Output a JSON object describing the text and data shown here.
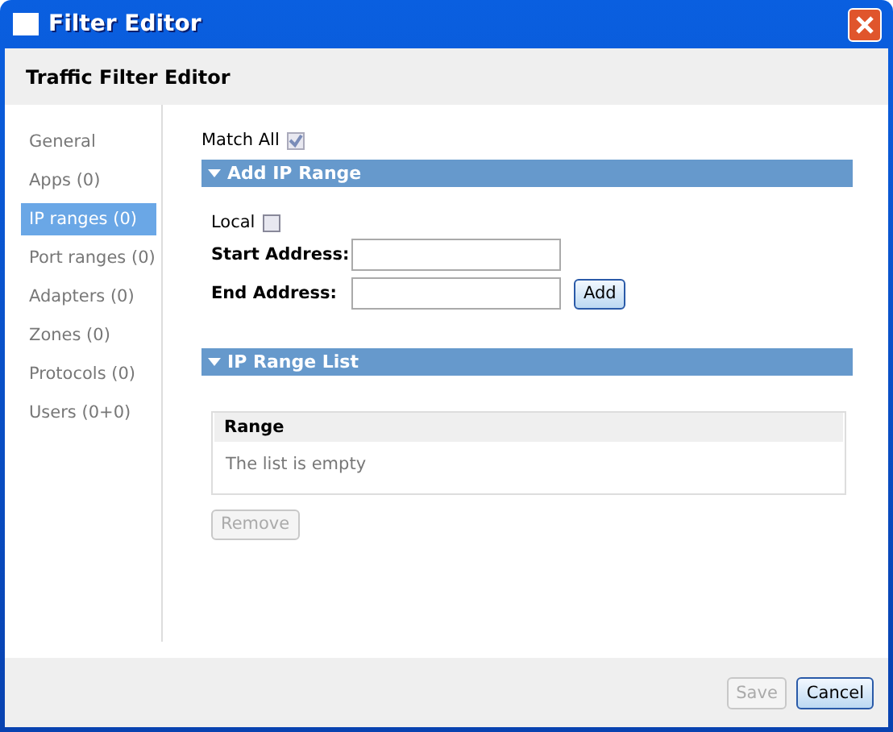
{
  "window": {
    "title": "Filter Editor"
  },
  "header": {
    "title": "Traffic Filter Editor"
  },
  "sidebar": {
    "items": [
      {
        "label": "General",
        "selected": false
      },
      {
        "label": "Apps (0)",
        "selected": false
      },
      {
        "label": "IP ranges (0)",
        "selected": true
      },
      {
        "label": "Port ranges (0)",
        "selected": false
      },
      {
        "label": "Adapters (0)",
        "selected": false
      },
      {
        "label": "Zones (0)",
        "selected": false
      },
      {
        "label": "Protocols (0)",
        "selected": false
      },
      {
        "label": "Users (0+0)",
        "selected": false
      }
    ]
  },
  "match_all": {
    "label": "Match All",
    "checked": true,
    "disabled": true
  },
  "add_section": {
    "title": "Add IP Range",
    "expanded": true,
    "local": {
      "label": "Local",
      "checked": false
    },
    "start_label": "Start Address:",
    "end_label": "End Address:",
    "add_button": "Add"
  },
  "list_section": {
    "title": "IP Range List",
    "expanded": true,
    "column": "Range",
    "empty_text": "The list is empty",
    "remove_button": {
      "label": "Remove",
      "disabled": true
    }
  },
  "footer": {
    "buttons": [
      {
        "label": "Save",
        "disabled": true
      },
      {
        "label": "Cancel",
        "disabled": false
      }
    ]
  }
}
